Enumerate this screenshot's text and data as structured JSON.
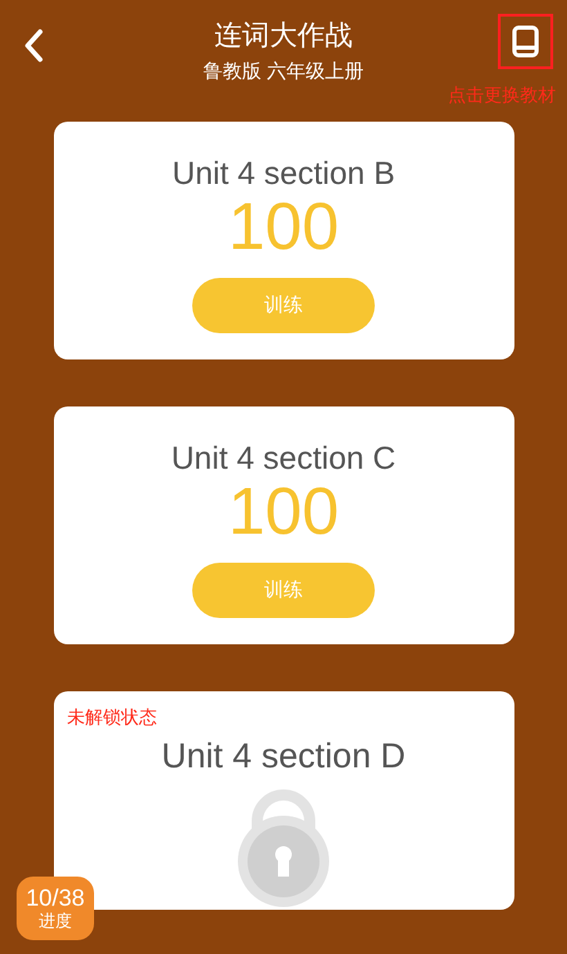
{
  "header": {
    "title": "连词大作战",
    "subtitle": "鲁教版 六年级上册",
    "annotation": "点击更换教材"
  },
  "units": [
    {
      "kind": "unlocked",
      "title": "Unit 4 section B",
      "score": "100",
      "button": "训练"
    },
    {
      "kind": "unlocked",
      "title": "Unit 4 section C",
      "score": "100",
      "button": "训练"
    },
    {
      "kind": "locked",
      "title": "Unit 4 section D",
      "annotation": "未解锁状态"
    }
  ],
  "progress": {
    "count": "10/38",
    "label": "进度"
  }
}
